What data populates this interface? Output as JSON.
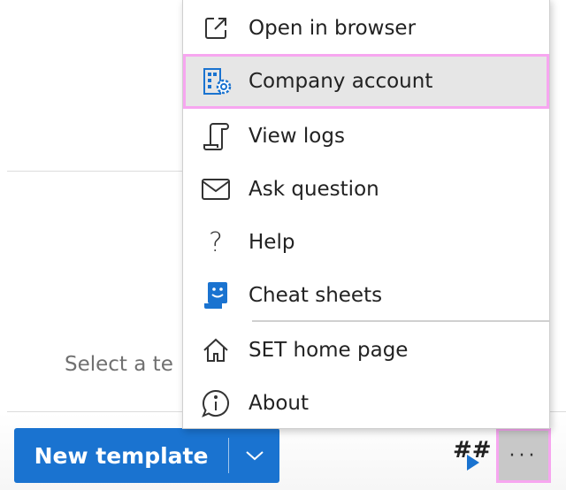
{
  "menu": {
    "items": [
      {
        "label": "Open in browser",
        "icon": "open-external-icon"
      },
      {
        "label": "Company account",
        "icon": "company-settings-icon",
        "selected": true
      },
      {
        "label": "View logs",
        "icon": "scroll-icon"
      },
      {
        "label": "Ask question",
        "icon": "mail-icon"
      },
      {
        "label": "Help",
        "icon": "question-icon"
      },
      {
        "label": "Cheat sheets",
        "icon": "cheat-sheet-icon"
      },
      {
        "label": "SET home page",
        "icon": "home-icon"
      },
      {
        "label": "About",
        "icon": "info-icon"
      }
    ]
  },
  "panel": {
    "placeholder": "Select a te"
  },
  "footer": {
    "new_template": "New template",
    "hash_label": "##",
    "more_label": "···"
  },
  "colors": {
    "accent": "#1a73d0",
    "highlight_border": "#f7a6f0"
  }
}
